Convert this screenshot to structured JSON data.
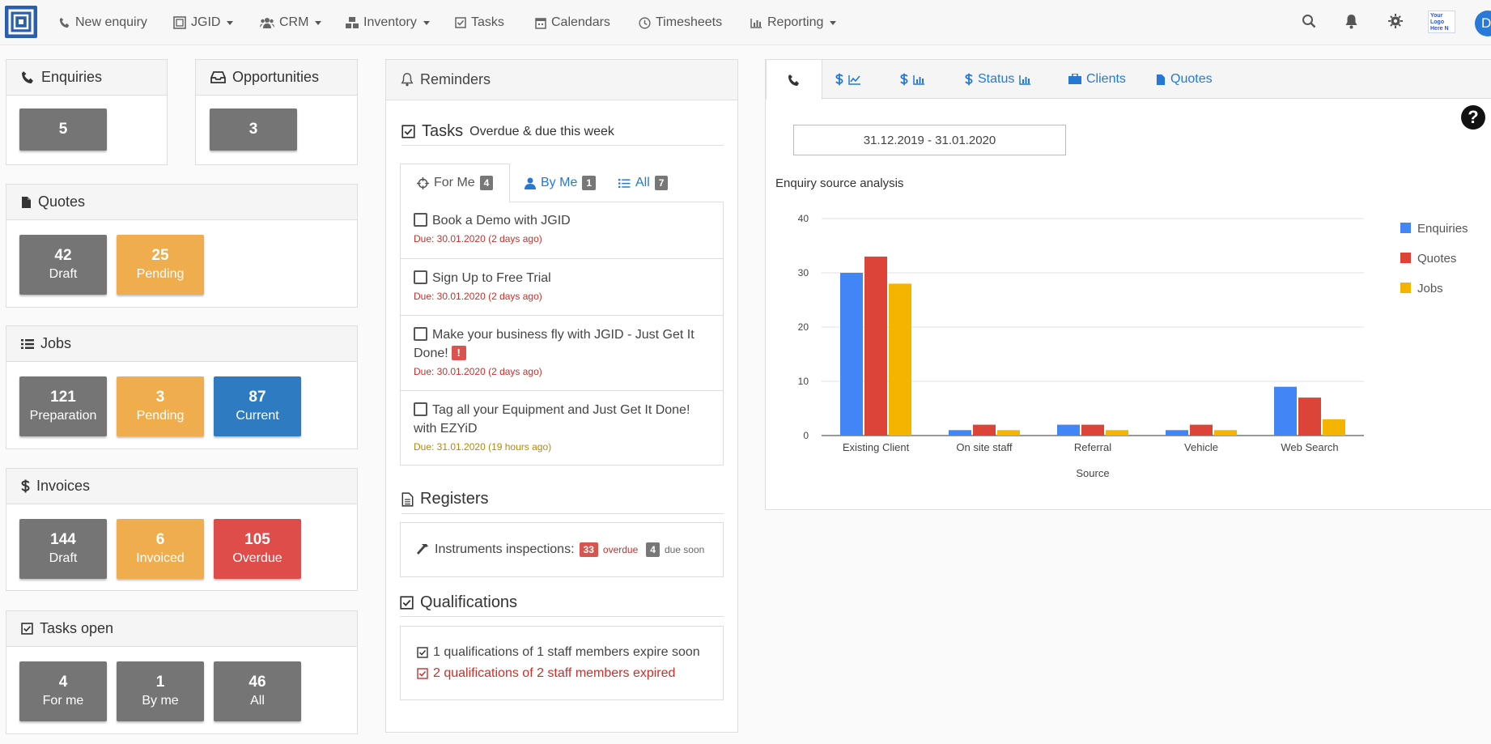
{
  "nav": {
    "new_enquiry": "New enquiry",
    "jgid": "JGID",
    "crm": "CRM",
    "inventory": "Inventory",
    "tasks": "Tasks",
    "calendars": "Calendars",
    "timesheets": "Timesheets",
    "reporting": "Reporting",
    "company_logo": "Your Logo Here N",
    "avatar": "D"
  },
  "enquiries": {
    "title": "Enquiries",
    "value": "5"
  },
  "opportunities": {
    "title": "Opportunities",
    "value": "3"
  },
  "quotes": {
    "title": "Quotes",
    "tiles": [
      {
        "n": "42",
        "l": "Draft"
      },
      {
        "n": "25",
        "l": "Pending"
      }
    ]
  },
  "jobs": {
    "title": "Jobs",
    "tiles": [
      {
        "n": "121",
        "l": "Preparation"
      },
      {
        "n": "3",
        "l": "Pending"
      },
      {
        "n": "87",
        "l": "Current"
      }
    ]
  },
  "invoices": {
    "title": "Invoices",
    "tiles": [
      {
        "n": "144",
        "l": "Draft"
      },
      {
        "n": "6",
        "l": "Invoiced"
      },
      {
        "n": "105",
        "l": "Overdue"
      }
    ]
  },
  "tasks_open": {
    "title": "Tasks open",
    "tiles": [
      {
        "n": "4",
        "l": "For me"
      },
      {
        "n": "1",
        "l": "By me"
      },
      {
        "n": "46",
        "l": "All"
      }
    ]
  },
  "reminders": {
    "title": "Reminders",
    "tasks_title": "Tasks",
    "tasks_sub": "Overdue & due this week",
    "tabs": [
      {
        "label": "For Me",
        "count": "4"
      },
      {
        "label": "By Me",
        "count": "1"
      },
      {
        "label": "All",
        "count": "7"
      }
    ],
    "items": [
      {
        "text": "Book a Demo with JGID",
        "due": "Due: 30.01.2020 (2 days ago)"
      },
      {
        "text": "Sign Up to Free Trial",
        "due": "Due: 30.01.2020 (2 days ago)"
      },
      {
        "text": "Make your business fly with JGID - Just Get It Done!",
        "due": "Due: 30.01.2020 (2 days ago)"
      },
      {
        "text": "Tag all your Equipment and Just Get It Done! with EZYiD",
        "due": "Due: 31.01.2020 (19 hours ago)"
      }
    ],
    "registers_title": "Registers",
    "register": {
      "label": "Instruments inspections:",
      "overdue_count": "33",
      "overdue": "overdue",
      "soon_count": "4",
      "soon": "due soon"
    },
    "qual_title": "Qualifications",
    "qual": [
      {
        "text": "1 qualifications of 1 staff members expire soon"
      },
      {
        "text": "2 qualifications of 2 staff members expired"
      }
    ]
  },
  "analytics": {
    "tabs": [
      "Status",
      "Clients",
      "Quotes"
    ],
    "date_range": "31.12.2019 - 31.01.2020",
    "help": "?"
  },
  "colors": {
    "enquiries": "#4285f4",
    "quotes": "#db4437",
    "jobs": "#f4b400"
  },
  "chart_data": {
    "type": "bar",
    "title": "Enquiry source analysis",
    "xlabel": "Source",
    "ylabel": "",
    "categories": [
      "Existing Client",
      "On site staff",
      "Referral",
      "Vehicle",
      "Web Search"
    ],
    "ylim": [
      0,
      40
    ],
    "yticks": [
      "0",
      "10",
      "20",
      "30",
      "40"
    ],
    "legend_position": "right",
    "grid": true,
    "series": [
      {
        "name": "Enquiries",
        "values": [
          30,
          1,
          2,
          1,
          9
        ]
      },
      {
        "name": "Quotes",
        "values": [
          33,
          2,
          2,
          2,
          7
        ]
      },
      {
        "name": "Jobs",
        "values": [
          28,
          1,
          1,
          1,
          3
        ]
      }
    ]
  }
}
